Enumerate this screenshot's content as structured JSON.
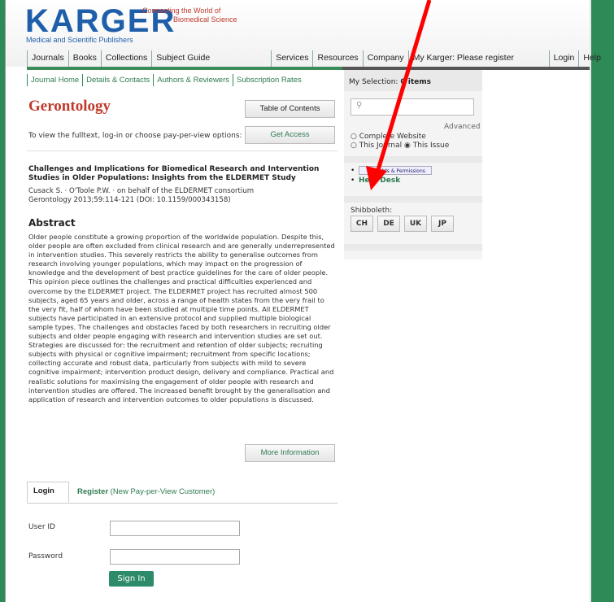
{
  "header": {
    "logo": "KARGER",
    "logo_subtitle": "Medical and Scientific Publishers",
    "tagline_line1": "Connecting the World of",
    "tagline_line2": "Biomedical Science"
  },
  "top_nav": {
    "items": [
      "Journals",
      "Books",
      "Collections",
      "Subject Guide"
    ],
    "items2": [
      "Services",
      "Resources",
      "Company"
    ],
    "my_karger": "My Karger: Please register",
    "login": "Login",
    "help": "Help"
  },
  "sub_nav": {
    "items": [
      "Journal Home",
      "Details & Contacts",
      "Authors & Reviewers",
      "Subscription Rates"
    ]
  },
  "journal": {
    "title": "Gerontology",
    "toc_button": "Table of Contents",
    "access_text": "To view the fulltext, log-in or choose pay-per-view options:",
    "access_button": "Get Access"
  },
  "article": {
    "title": "Challenges and Implications for Biomedical Research and Intervention Studies in Older Populations: Insights from the ELDERMET Study",
    "authors": "Cusack S. · O'Toole P.W. · on behalf of the ELDERMET consortium",
    "citation": "Gerontology 2013;59:114-121 (DOI: 10.1159/000343158)",
    "abstract_heading": "Abstract",
    "abstract": "Older people constitute a growing proportion of the worldwide population. Despite this, older people are often excluded from clinical research and are generally underrepresented in intervention studies. This severely restricts the ability to generalise outcomes from research involving younger populations, which may impact on the progression of knowledge and the development of best practice guidelines for the care of older people. This opinion piece outlines the challenges and practical difficulties experienced and overcome by the ELDERMET project. The ELDERMET project has recruited almost 500 subjects, aged 65 years and older, across a range of health states from the very frail to the very fit, half of whom have been studied at multiple time points. All ELDERMET subjects have participated in an extensive protocol and supplied multiple biological sample types. The challenges and obstacles faced by both researchers in recruiting older subjects and older people engaging with research and intervention studies are set out. Strategies are discussed for: the recruitment and retention of older subjects; recruiting subjects with physical or cognitive impairment; recruitment from specific locations; collecting accurate and robust data, particularly from subjects with mild to severe cognitive impairment; intervention product design, delivery and compliance. Practical and realistic solutions for maximising the engagement of older people with research and intervention studies are offered. The increased benefit brought by the generalisation and application of research and intervention outcomes to older populations is discussed.",
    "more_button": "More Information"
  },
  "login_form": {
    "tab_login": "Login",
    "tab_register": "Register",
    "tab_register_note": "(New Pay-per-View Customer)",
    "user_label": "User ID",
    "password_label": "Password",
    "signin_button": "Sign In"
  },
  "sidebar": {
    "selection_label": "My Selection:",
    "selection_count": "0 items",
    "search_placeholder": "",
    "advanced": "Advanced",
    "radio_complete": "Complete Website",
    "radio_journal": "This Journal",
    "radio_issue": "This Issue",
    "permissions": "Rights & Permissions",
    "helpdesk": "Help Desk",
    "shibboleth_label": "Shibboleth:",
    "shib_buttons": [
      "CH",
      "DE",
      "UK",
      "JP"
    ]
  },
  "colors": {
    "brand_blue": "#1f5faa",
    "brand_red": "#c0392b",
    "frame_green": "#2e8b57",
    "annotation_arrow": "#ff0000"
  }
}
